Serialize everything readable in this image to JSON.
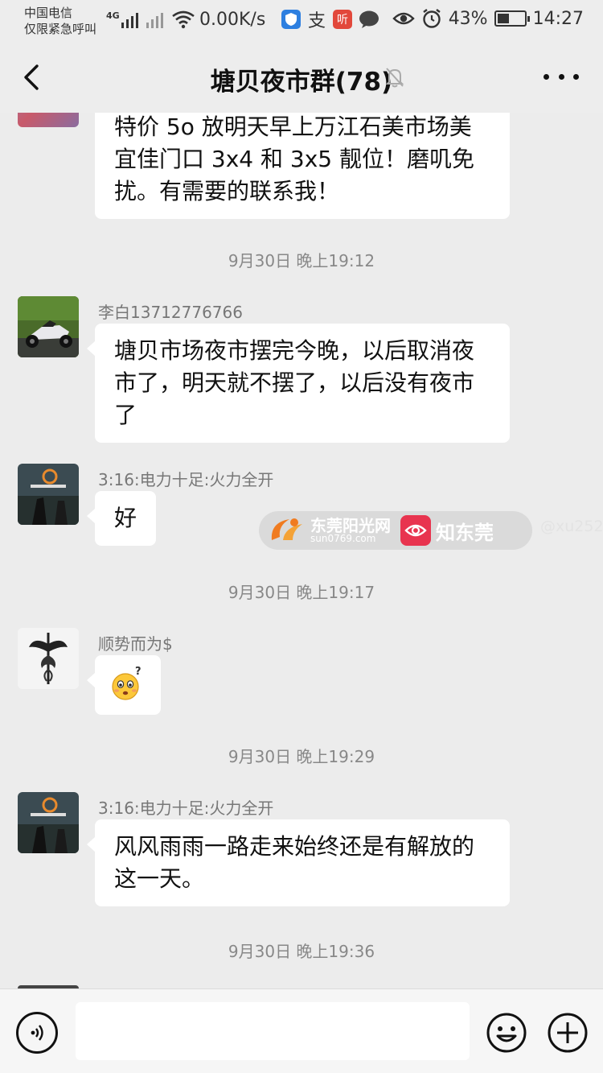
{
  "status_bar": {
    "carrier_line1": "中国电信",
    "carrier_line2": "仅限紧急呼叫",
    "network_label": "4G",
    "net_speed": "0.00K/s",
    "app_icon_text_1": "支",
    "app_icon_text_2": "听",
    "battery_percent": "43%",
    "battery_level": 0.43,
    "time": "14:27"
  },
  "header": {
    "title": "塘贝夜市群(78)"
  },
  "messages": [
    {
      "type": "text",
      "sender": "",
      "text": "特价 5o 放明天早上万江石美市场美宜佳门口 3x4 和 3x5 靓位！磨叽免扰。有需要的联系我！"
    },
    {
      "type": "time",
      "text": "9月30日 晚上19:12"
    },
    {
      "type": "text",
      "sender": "李白13712776766",
      "text": "塘贝市场夜市摆完今晚，以后取消夜市了，明天就不摆了，以后没有夜市了"
    },
    {
      "type": "text",
      "sender": "3:16:电力十足:火力全开",
      "text": "好"
    },
    {
      "type": "time",
      "text": "9月30日 晚上19:17"
    },
    {
      "type": "sticker",
      "sender": "顺势而为$",
      "sticker": "confused-face-emoji"
    },
    {
      "type": "time",
      "text": "9月30日 晚上19:29"
    },
    {
      "type": "text",
      "sender": "3:16:电力十足:火力全开",
      "text": "风风雨雨一路走来始终还是有解放的这一天。"
    },
    {
      "type": "time",
      "text": "9月30日 晚上19:36"
    }
  ],
  "watermark": {
    "name1": "东莞阳光网",
    "url1": "sun0769.com",
    "name2": "知东莞",
    "extra": "@xu2525"
  },
  "input_bar": {
    "placeholder": "",
    "value": ""
  },
  "icons": {
    "back": "chevron-left-icon",
    "mute": "bell-off-icon",
    "more": "more-dots-icon",
    "voice": "voice-icon",
    "emoji": "emoji-icon",
    "add": "plus-icon"
  },
  "colors": {
    "background": "#ececec",
    "bubble": "#ffffff",
    "watermark_accent": "#e8344f",
    "watermark_orange": "#f07b20"
  }
}
